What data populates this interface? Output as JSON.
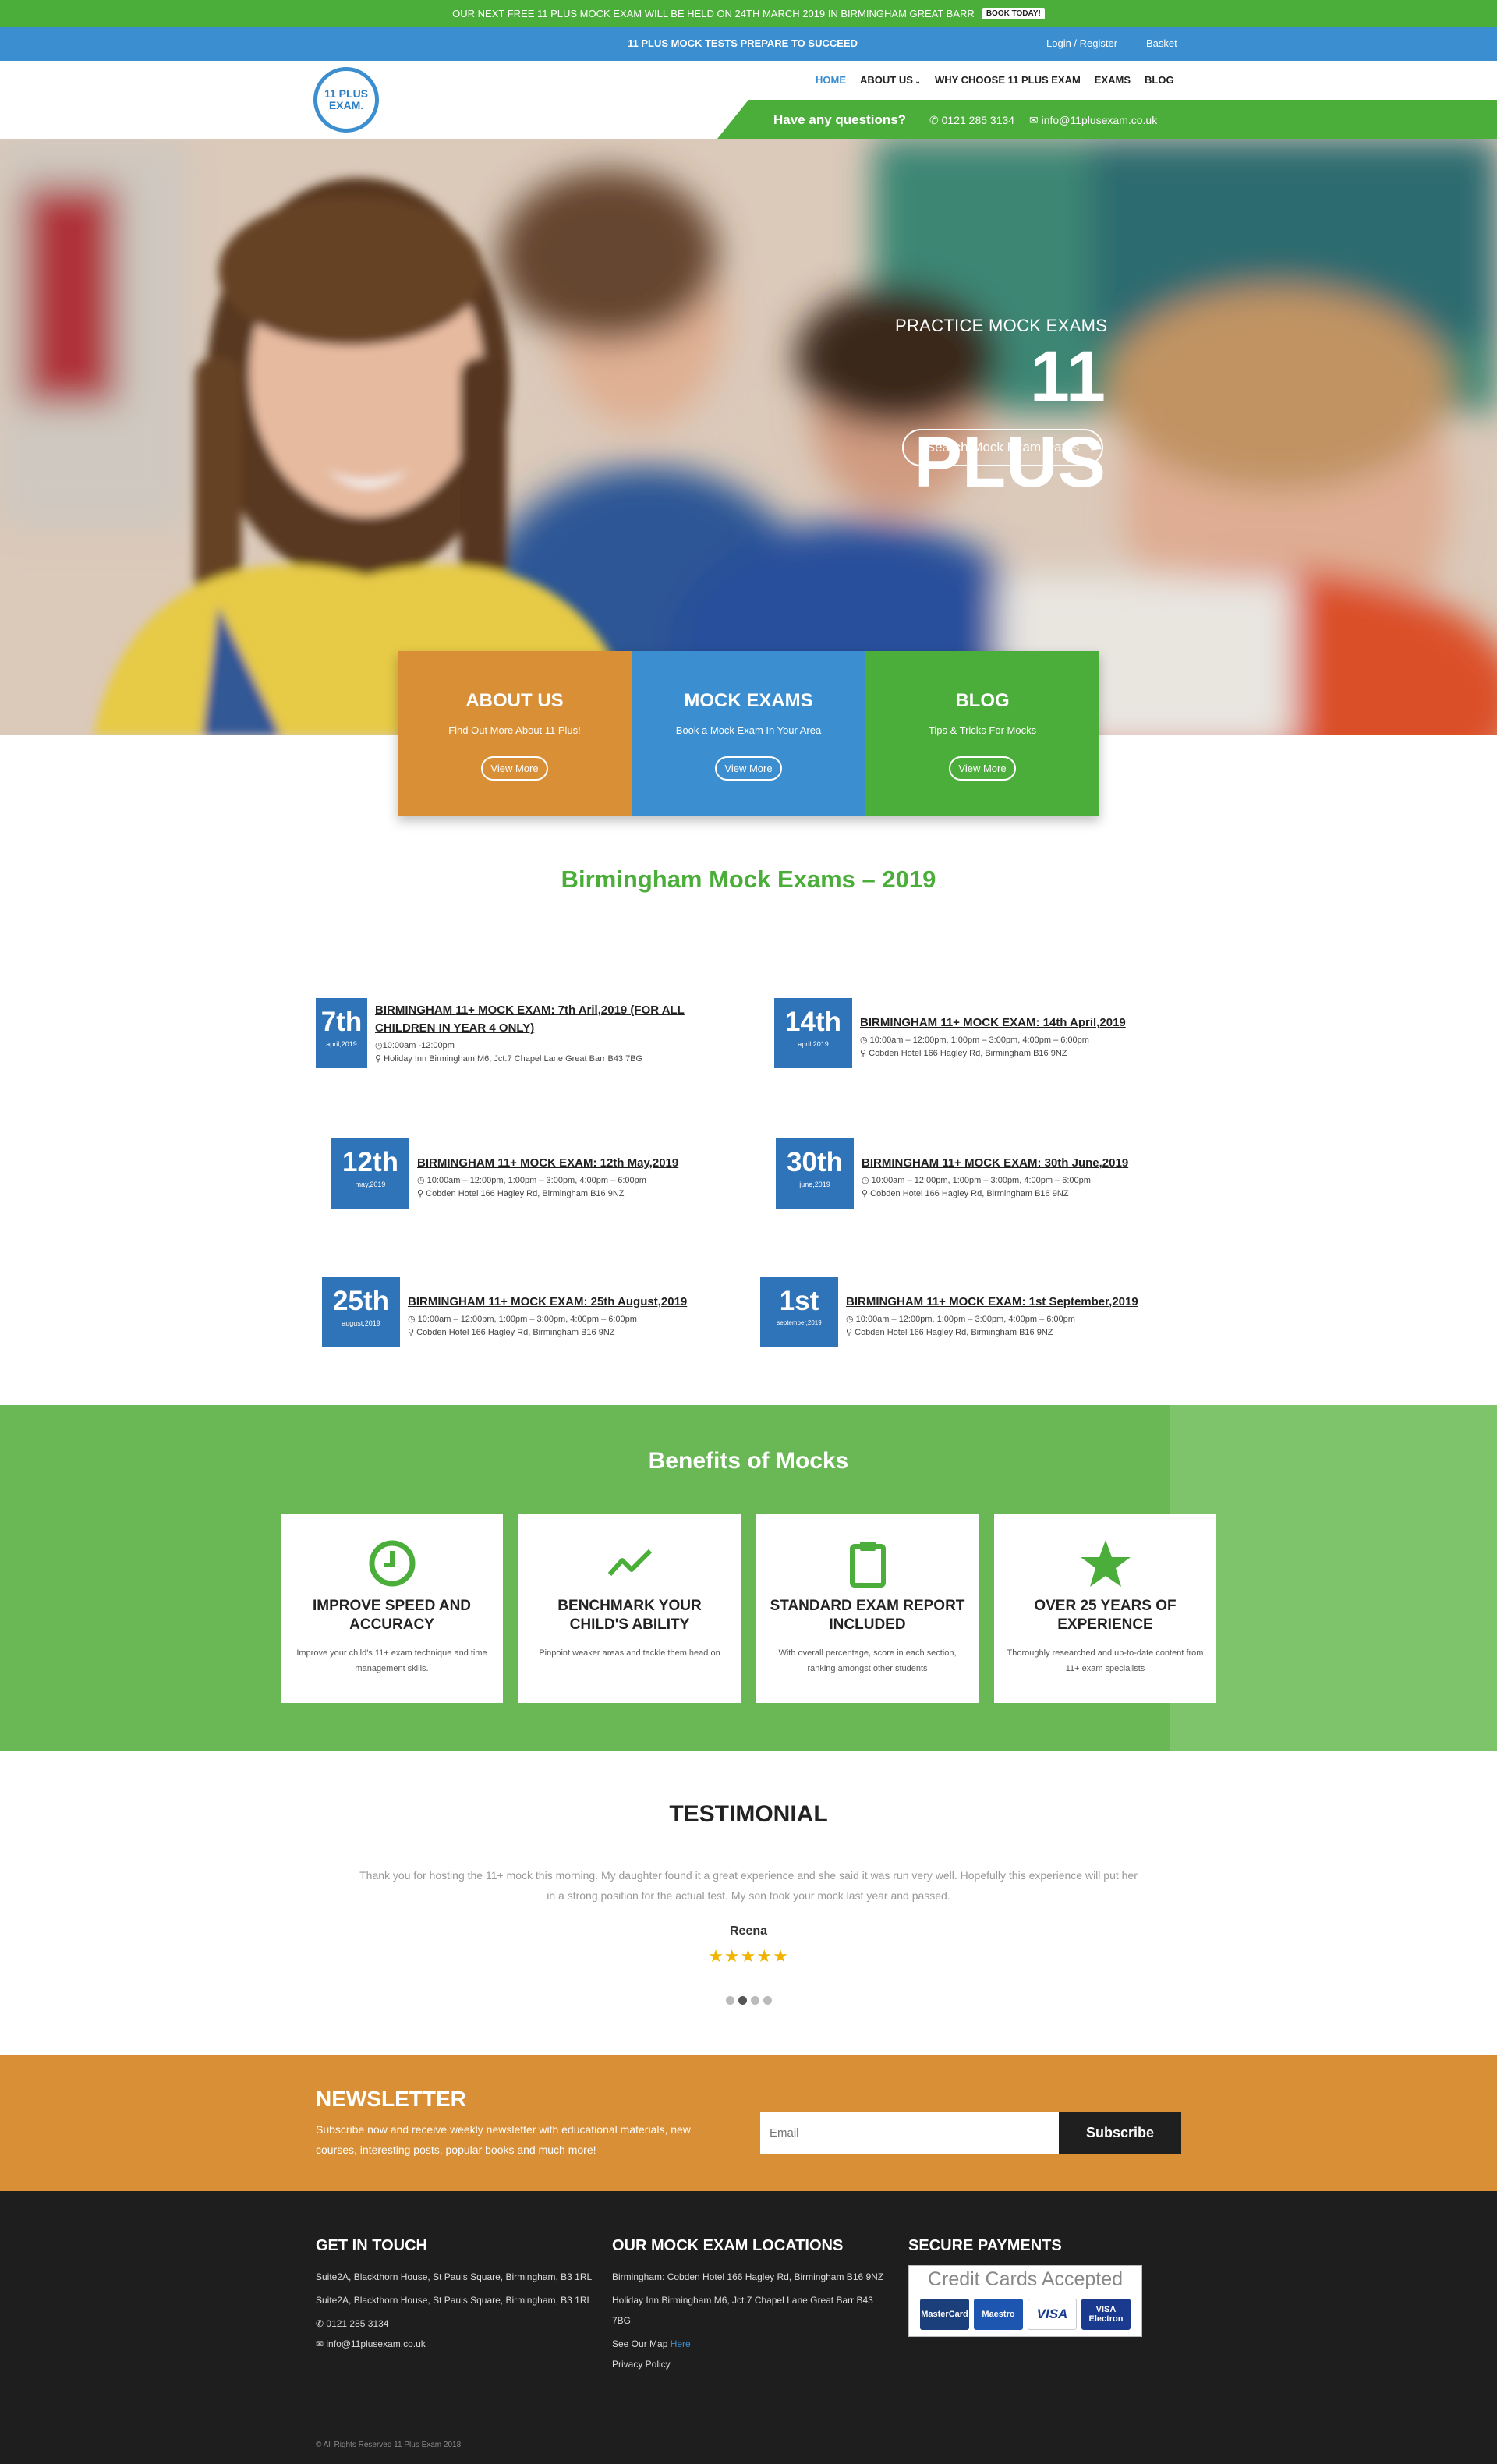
{
  "promo": {
    "text": "OUR NEXT FREE 11 PLUS MOCK EXAM WILL BE HELD ON 24TH MARCH 2019 IN BIRMINGHAM GREAT BARR",
    "button": "BOOK TODAY!"
  },
  "topbar": {
    "tagline": "11 PLUS MOCK TESTS PREPARE TO SUCCEED",
    "login": "Login / Register",
    "basket": "Basket"
  },
  "logo": {
    "line1": "11 PLUS",
    "line2": "EXAM."
  },
  "nav": {
    "items": [
      "HOME",
      "ABOUT US",
      "WHY CHOOSE 11 PLUS EXAM",
      "EXAMS",
      "BLOG"
    ]
  },
  "contact": {
    "question": "Have any questions?",
    "phone": "0121 285 3134",
    "email": "info@11plusexam.co.uk"
  },
  "hero": {
    "subtitle": "PRACTICE MOCK EXAMS",
    "title": "11 PLUS",
    "button": "Search Mock Exam Dates"
  },
  "tiles": [
    {
      "title": "ABOUT US",
      "text": "Find Out More About 11 Plus!",
      "button": "View More",
      "color": "#d98f36"
    },
    {
      "title": "MOCK EXAMS",
      "text": "Book a Mock Exam In Your Area",
      "button": "View More",
      "color": "#3b8fd0"
    },
    {
      "title": "BLOG",
      "text": "Tips & Tricks For Mocks",
      "button": "View More",
      "color": "#4cae3a"
    }
  ],
  "section_title": "Birmingham Mock Exams – 2019",
  "events": [
    {
      "day": "7th",
      "month": "april,2019",
      "title_l1": "BIRMINGHAM 11+ MOCK EXAM: 7th Aril,2019 (FOR ALL",
      "title_l2": "CHILDREN IN YEAR 4 ONLY)",
      "time": "10:00am -12:00pm",
      "place": "Holiday Inn Birmingham M6, Jct.7 Chapel Lane Great Barr B43 7BG"
    },
    {
      "day": "14th",
      "month": "april,2019",
      "title_l1": "BIRMINGHAM 11+ MOCK EXAM: 14th April,2019",
      "title_l2": "",
      "time": "10:00am – 12:00pm, 1:00pm – 3:00pm, 4:00pm – 6:00pm",
      "place": "Cobden Hotel 166 Hagley Rd, Birmingham B16 9NZ"
    },
    {
      "day": "12th",
      "month": "may,2019",
      "title_l1": "BIRMINGHAM 11+ MOCK EXAM: 12th May,2019",
      "title_l2": "",
      "time": "10:00am – 12:00pm, 1:00pm – 3:00pm, 4:00pm – 6:00pm",
      "place": "Cobden Hotel 166 Hagley Rd, Birmingham B16 9NZ"
    },
    {
      "day": "30th",
      "month": "june,2019",
      "title_l1": "BIRMINGHAM 11+ MOCK EXAM: 30th June,2019",
      "title_l2": "",
      "time": "10:00am – 12:00pm, 1:00pm – 3:00pm, 4:00pm – 6:00pm",
      "place": "Cobden Hotel 166 Hagley Rd, Birmingham B16 9NZ"
    },
    {
      "day": "25th",
      "month": "august,2019",
      "title_l1": "BIRMINGHAM 11+ MOCK EXAM: 25th August,2019",
      "title_l2": "",
      "time": "10:00am – 12:00pm, 1:00pm – 3:00pm, 4:00pm – 6:00pm",
      "place": "Cobden Hotel 166 Hagley Rd, Birmingham B16 9NZ"
    },
    {
      "day": "1st",
      "month": "september,2019",
      "title_l1": "BIRMINGHAM 11+ MOCK EXAM: 1st September,2019",
      "title_l2": "",
      "time": "10:00am – 12:00pm, 1:00pm – 3:00pm, 4:00pm – 6:00pm",
      "place": "Cobden Hotel 166 Hagley Rd, Birmingham B16 9NZ"
    }
  ],
  "benefits": {
    "title": "Benefits of Mocks",
    "cards": [
      {
        "icon": "clock-icon",
        "title_l1": "IMPROVE SPEED AND",
        "title_l2": "ACCURACY",
        "text": "Improve your child's 11+ exam technique and time management skills."
      },
      {
        "icon": "trend-line-icon",
        "title_l1": "BENCHMARK YOUR",
        "title_l2": "CHILD'S ABILITY",
        "text": "Pinpoint weaker areas and tackle them head on"
      },
      {
        "icon": "clipboard-icon",
        "title_l1": "STANDARD EXAM REPORT",
        "title_l2": "INCLUDED",
        "text": "With overall percentage, score in each section, ranking amongst other students"
      },
      {
        "icon": "star-icon",
        "title_l1": "OVER 25 YEARS OF",
        "title_l2": "EXPERIENCE",
        "text": "Thoroughly researched and up-to-date content from 11+ exam specialists"
      }
    ]
  },
  "testimonial": {
    "title": "TESTIMONIAL",
    "quote": "Thank you for hosting the 11+ mock this morning. My daughter found it a great experience and she said it was run very well. Hopefully this experience will put her in a strong position for the actual test. My son took your mock last year and passed.",
    "name": "Reena",
    "rating": 5,
    "stars": "★★★★★"
  },
  "newsletter": {
    "title": "NEWSLETTER",
    "text": "Subscribe now and receive weekly newsletter with educational materials, new courses, interesting posts, popular books and much more!",
    "placeholder": "Email",
    "button": "Subscribe"
  },
  "footer": {
    "get_in_touch": {
      "title": "GET IN TOUCH",
      "addr1": "Suite2A, Blackthorn House, St Pauls Square, Birmingham, B3 1RL",
      "addr2": "Suite2A, Blackthorn House, St Pauls Square, Birmingham, B3 1RL",
      "phone": "0121 285 3134",
      "email": "info@11plusexam.co.uk"
    },
    "locations": {
      "title": "OUR MOCK EXAM LOCATIONS",
      "loc1": "Birmingham: Cobden Hotel 166 Hagley Rd, Birmingham B16 9NZ",
      "loc2": "Holiday Inn Birmingham M6, Jct.7 Chapel Lane Great Barr B43 7BG",
      "map_text": "See Our Map",
      "map_link": "Here",
      "privacy": "Privacy Policy"
    },
    "payments": {
      "title": "SECURE PAYMENTS",
      "banner": "Credit Cards Accepted",
      "cards": [
        "MasterCard",
        "Maestro",
        "VISA",
        "VISA Electron"
      ]
    },
    "copyright": "© All Rights Reserved 11 Plus Exam 2018"
  }
}
